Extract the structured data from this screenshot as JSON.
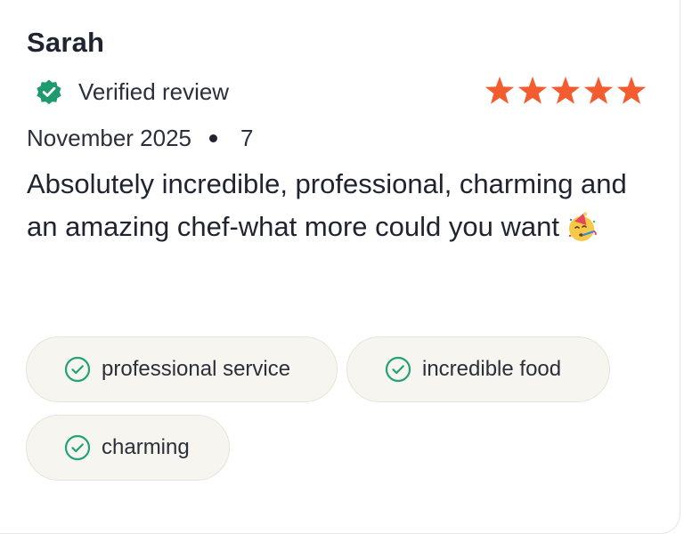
{
  "review": {
    "author": "Sarah",
    "verified_label": "Verified review",
    "rating": 5,
    "rating_max": 5,
    "date": "November 2025",
    "count": "7",
    "text": "Absolutely incredible, professional, charming and an amazing chef-what more could you want",
    "emoji": "partying-face"
  },
  "tags": [
    {
      "label": "professional service",
      "icon": "check-circle-icon"
    },
    {
      "label": "incredible food",
      "icon": "check-circle-icon"
    },
    {
      "label": "charming",
      "icon": "check-circle-icon"
    }
  ],
  "colors": {
    "star": "#f25c2e",
    "verified_badge": "#1f9a6e",
    "tag_icon": "#22a37a",
    "tag_background": "#f7f5f0",
    "text": "#1f2430"
  }
}
